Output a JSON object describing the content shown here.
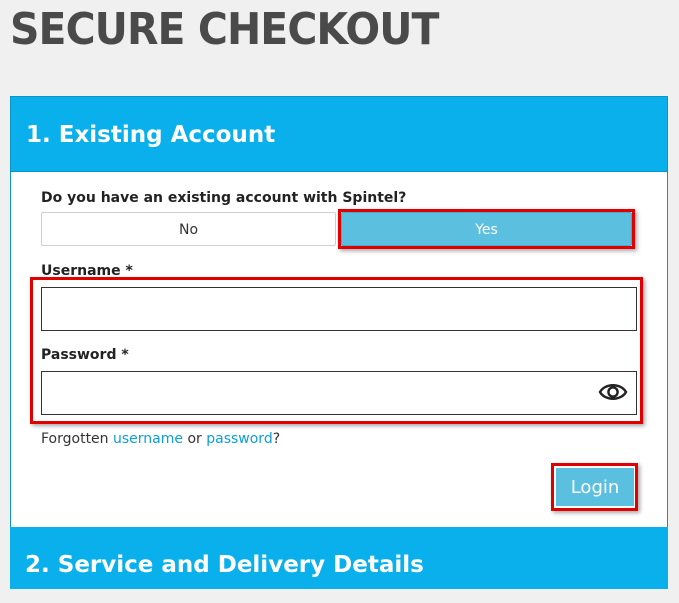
{
  "page": {
    "title": "SECURE CHECKOUT"
  },
  "section1": {
    "title": "1. Existing Account"
  },
  "account_question": "Do you have an existing account with Spintel?",
  "toggle": {
    "no_label": "No",
    "yes_label": "Yes",
    "selected": "Yes"
  },
  "form": {
    "username_label": "Username *",
    "username_value": "",
    "password_label": "Password *",
    "password_value": ""
  },
  "forgot": {
    "prefix": "Forgotten ",
    "username_link": "username",
    "or": " or ",
    "password_link": "password",
    "suffix": "?"
  },
  "login": {
    "label": "Login"
  },
  "section2": {
    "title": "2. Service and Delivery Details"
  },
  "colors": {
    "accent": "#0ab0ec",
    "button": "#5bbfe0",
    "highlight": "#e00000",
    "link": "#0a9fd8"
  },
  "icons": {
    "password_toggle": "eye-icon"
  }
}
